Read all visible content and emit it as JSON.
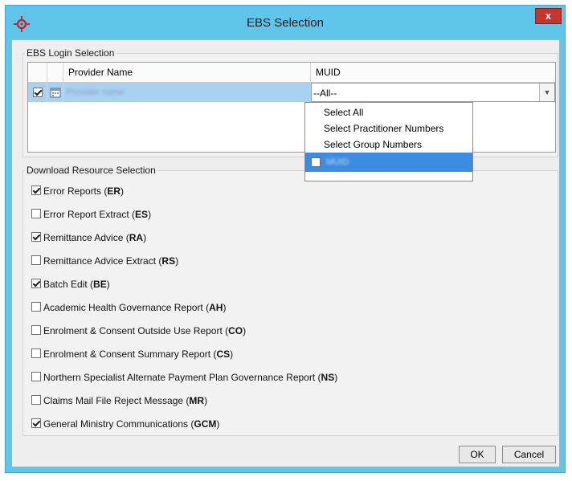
{
  "window": {
    "title": "EBS Selection",
    "close_label": "x"
  },
  "login_selection": {
    "legend": "EBS Login Selection",
    "columns": {
      "provider_name": "Provider Name",
      "muid": "MUID"
    },
    "row": {
      "checked": true,
      "provider_name": "Provider name",
      "muid_value": "--All--"
    }
  },
  "muid_dropdown": {
    "items": [
      "Select All",
      "Select Practitioner Numbers",
      "Select Group Numbers"
    ],
    "option": {
      "checked": false,
      "label": "MUID"
    }
  },
  "resource_selection": {
    "legend": "Download Resource Selection",
    "items": [
      {
        "label": "Error Reports",
        "code": "ER",
        "checked": true
      },
      {
        "label": "Error Report Extract",
        "code": "ES",
        "checked": false
      },
      {
        "label": "Remittance Advice",
        "code": "RA",
        "checked": true
      },
      {
        "label": "Remittance Advice Extract",
        "code": "RS",
        "checked": false
      },
      {
        "label": "Batch Edit",
        "code": "BE",
        "checked": true
      },
      {
        "label": "Academic Health Governance Report",
        "code": "AH",
        "checked": false
      },
      {
        "label": "Enrolment & Consent Outside Use Report",
        "code": "CO",
        "checked": false
      },
      {
        "label": "Enrolment & Consent Summary Report",
        "code": "CS",
        "checked": false
      },
      {
        "label": "Northern Specialist Alternate Payment Plan Governance Report",
        "code": "NS",
        "checked": false
      },
      {
        "label": "Claims Mail File Reject Message",
        "code": "MR",
        "checked": false
      },
      {
        "label": "General Ministry Communications",
        "code": "GCM",
        "checked": true
      }
    ]
  },
  "buttons": {
    "ok": "OK",
    "cancel": "Cancel"
  },
  "colors": {
    "title_bar": "#5fc6ea",
    "close_button": "#c4362c",
    "row_selected": "#a9d1f2",
    "dropdown_selected": "#3c8de1",
    "app_icon": "#c1272d"
  }
}
